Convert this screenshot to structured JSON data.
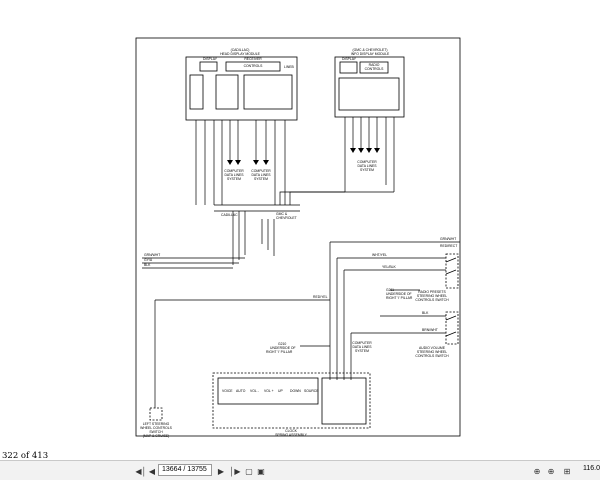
{
  "viewer": {
    "page_indicator": "322 of 413",
    "page_field": "13664 / 13755",
    "zoom": "116.0"
  },
  "icons": {
    "first": "first-page-icon",
    "prev": "previous-page-icon",
    "next": "next-page-icon",
    "last": "last-page-icon",
    "fit_width": "fit-width-icon",
    "fit_page": "fit-page-icon",
    "zoom_out": "zoom-out-icon",
    "zoom_in": "zoom-in-icon"
  },
  "diagram": {
    "cadillac_module": {
      "title1": "(CADILLAC)",
      "title2": "HEAD DISPLAY MODULE",
      "sub": "RECEIVER",
      "sub2": "CONTROLS",
      "display": "DISPLAY",
      "lineb": "LINEB"
    },
    "chevy_module": {
      "title1": "(GMC & CHEVROLET)",
      "title2": "INFO DISPLAY MODULE",
      "display": "DISPLAY",
      "radio": "RADIO",
      "controls": "CONTROLS"
    },
    "computer_data_lines": [
      "COMPUTER",
      "DATA LINES",
      "SYSTEM"
    ],
    "cadillac_conn": "CADILLAC",
    "gmc_conn": "GMC &",
    "gmc_conn2": "CHEVROLET",
    "wires_left": [
      "GRN/WHT",
      "GY/A",
      "BLK"
    ],
    "wire_red_yel": "RED/YEL",
    "wire_wht_yel": "WHT/YEL",
    "wire_yel_blk": "YEL/BLK",
    "wire_blk": "BLK",
    "wire_brn_wht": "BRN/WHT",
    "radio_presets": [
      "RADIO PRESETS",
      "STEERING WHEEL",
      "CONTROLS SWITCH"
    ],
    "audio_volume": [
      "AUDIO VOLUME",
      "STEERING WHEEL",
      "CONTROLS SWITCH"
    ],
    "ground_1": [
      "G211",
      "UNDERSIDE OF",
      "RIGHT 'I' PILLAR"
    ],
    "ground_2": [
      "G210",
      "UNDERSIDE OF",
      "RIGHT 'I' PILLAR"
    ],
    "coil_labels": [
      "VOICE",
      "AUTO",
      "VOL -",
      "VOL +",
      "UP",
      "DOWN",
      "SOURCE"
    ],
    "clock_spring_1": "CLOCK",
    "clock_spring_2": "SPRING ASSEMBLY",
    "left_switch": [
      "LEFT STEERING",
      "WHEEL CONTROLS",
      "SWITCH",
      "(MAP & CRUISE)"
    ],
    "grn_wht_top": "GRN/WHT",
    "right_label": "REDIRECT"
  }
}
